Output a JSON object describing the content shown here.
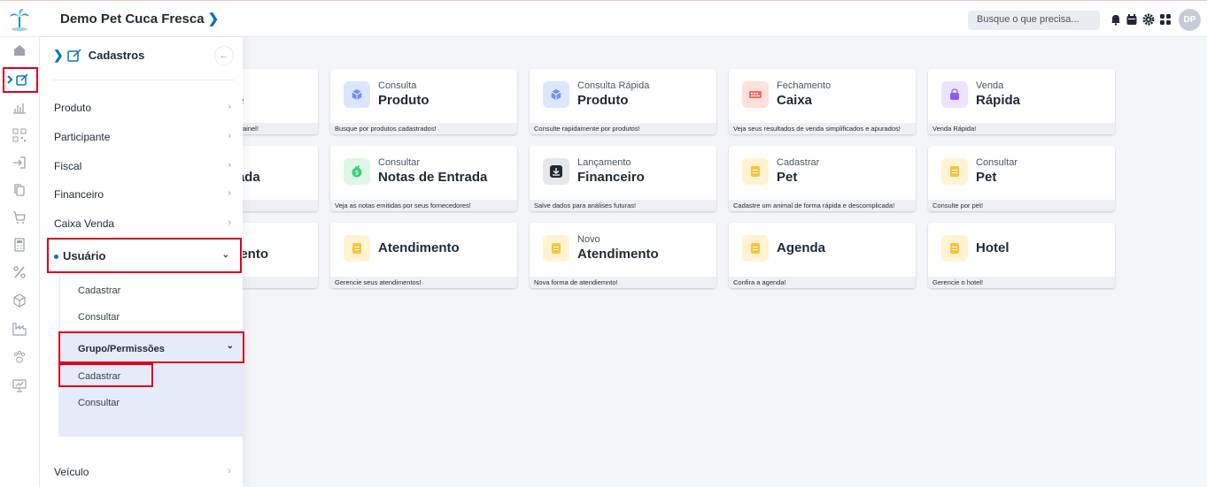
{
  "header": {
    "app_title": "Demo Pet Cuca Fresca",
    "search_placeholder": "Busque o que precisa...",
    "avatar_initials": "DP"
  },
  "drawer": {
    "title": "Cadastros",
    "items": [
      {
        "label": "Produto"
      },
      {
        "label": "Participante"
      },
      {
        "label": "Fiscal"
      },
      {
        "label": "Financeiro"
      },
      {
        "label": "Caixa Venda"
      }
    ],
    "usuario": {
      "label": "Usuário",
      "cadastrar": "Cadastrar",
      "consultar": "Consultar",
      "grupo": {
        "label": "Grupo/Permissões",
        "cadastrar": "Cadastrar",
        "consultar": "Consultar"
      }
    },
    "veiculo": "Veículo"
  },
  "partials": {
    "row1_title": "te",
    "row1_foot": "ainel!",
    "row2_title": "trada",
    "row3_title": "mento"
  },
  "cards": [
    {
      "sub": "Consulta",
      "title": "Produto",
      "foot": "Busque por produtos cadastrados!",
      "icon": "cube-icon",
      "color": "#dbe7ff"
    },
    {
      "sub": "Consulta Rápida",
      "title": "Produto",
      "foot": "Consulte rapidamente por produtos!",
      "icon": "cube-icon",
      "color": "#dbe7ff"
    },
    {
      "sub": "Fechamento",
      "title": "Caixa",
      "foot": "Veja seus resultados de venda simplificados e apurados!",
      "icon": "register-icon",
      "color": "#ffe0dc"
    },
    {
      "sub": "Venda",
      "title": "Rápida",
      "foot": "Venda Rápida!",
      "icon": "bag-icon",
      "color": "#ece3ff"
    },
    {
      "sub": "Consultar",
      "title": "Notas de Entrada",
      "foot": "Veja as notas emitidas por seus fornecedores!",
      "icon": "invoice-icon",
      "color": "#dcf7e6"
    },
    {
      "sub": "Lançamento",
      "title": "Financeiro",
      "foot": "Salve dados para análises futuras!",
      "icon": "download-icon",
      "color": "#e5e7eb"
    },
    {
      "sub": "Cadastrar",
      "title": "Pet",
      "foot": "Cadastre um animal de forma rápida e descomplicada!",
      "icon": "note-icon",
      "color": "#fff3d1"
    },
    {
      "sub": "Consultar",
      "title": "Pet",
      "foot": "Consulte por pet!",
      "icon": "note-icon",
      "color": "#fff3d1"
    },
    {
      "sub": "",
      "title": "Atendimento",
      "foot": "Gerencie seus atendimentos!",
      "icon": "note-icon",
      "color": "#fff3d1"
    },
    {
      "sub": "Novo",
      "title": "Atendimento",
      "foot": "Nova forma de atendiemnto!",
      "icon": "note-icon",
      "color": "#fff3d1"
    },
    {
      "sub": "",
      "title": "Agenda",
      "foot": "Confira a agenda!",
      "icon": "note-icon",
      "color": "#fff3d1"
    },
    {
      "sub": "",
      "title": "Hotel",
      "foot": "Gerencie o hotel!",
      "icon": "note-icon",
      "color": "#fff3d1"
    }
  ]
}
